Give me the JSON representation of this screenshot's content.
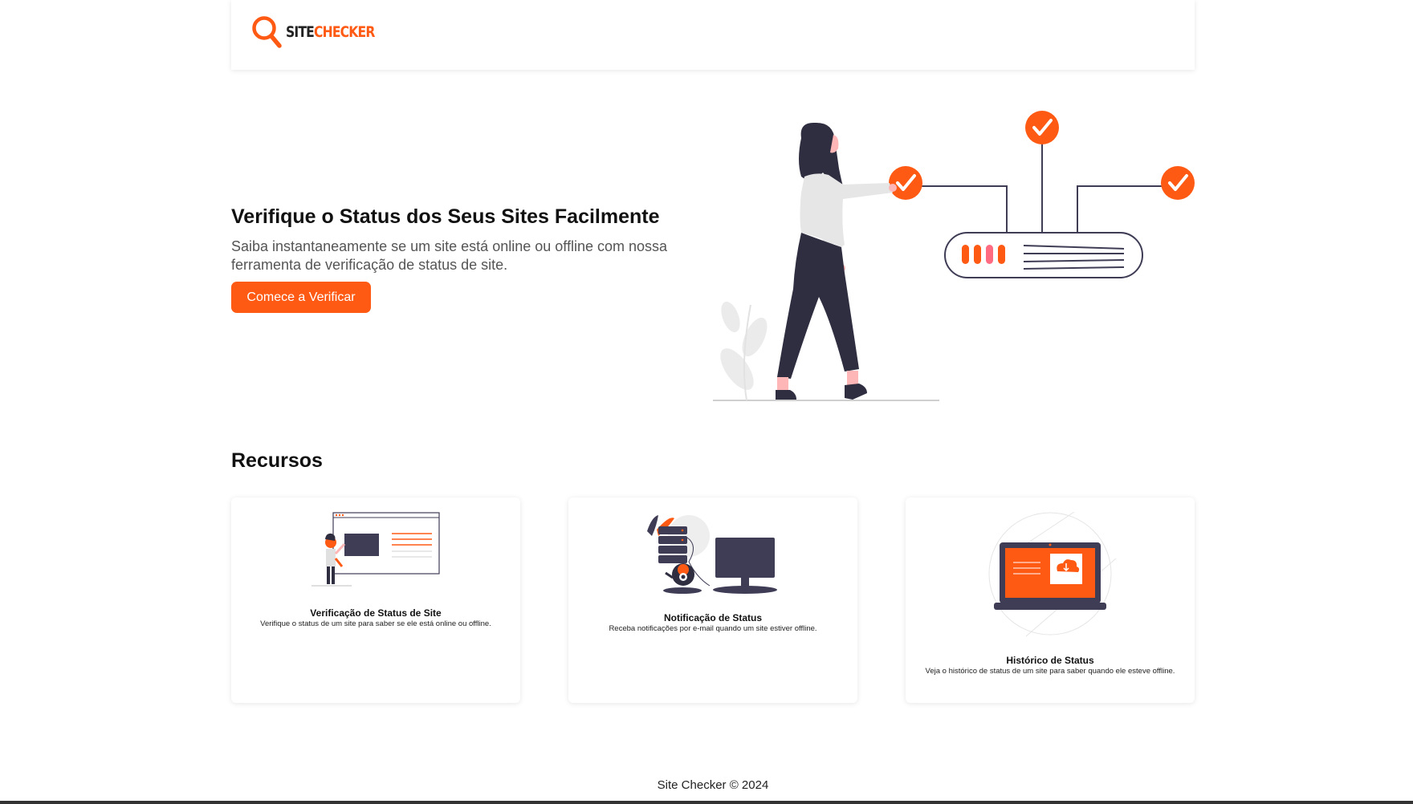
{
  "brand": {
    "logo_part1": "SITE",
    "logo_part2": "CHECKER",
    "logo_icon": "magnifier-icon",
    "accent_color": "#ff5a14"
  },
  "hero": {
    "title": "Verifique o Status dos Seus Sites Facilmente",
    "subtitle": "Saiba instantaneamente se um site está online ou offline com nossa ferramenta de verificação de status de site.",
    "cta_label": "Comece a Verificar",
    "illustration": "woman-server-checkmarks-illustration"
  },
  "resources": {
    "title": "Recursos",
    "cards": [
      {
        "title": "Verificação de Status de Site",
        "text": "Verifique o status de um site para saber se ele está online ou offline.",
        "illustration": "person-presentation-illustration"
      },
      {
        "title": "Notificação de Status",
        "text": "Receba notificações por e-mail quando um site estiver offline.",
        "illustration": "server-monitor-illustration"
      },
      {
        "title": "Histórico de Status",
        "text": "Veja o histórico de status de um site para saber quando ele esteve offline.",
        "illustration": "laptop-cloud-illustration"
      }
    ]
  },
  "footer": {
    "text": "Site Checker © 2024"
  }
}
